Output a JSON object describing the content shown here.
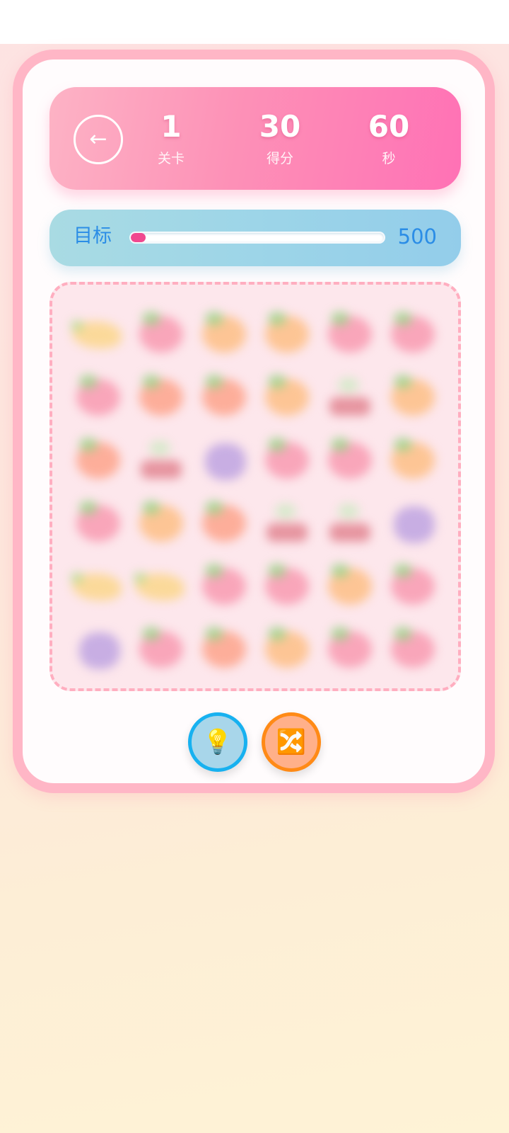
{
  "header": {
    "back_icon": "←",
    "level": {
      "value": "1",
      "label": "关卡"
    },
    "score": {
      "value": "30",
      "label": "得分"
    },
    "timer": {
      "value": "60",
      "label": "秒"
    }
  },
  "target": {
    "label": "目标",
    "value": "500",
    "progress_fraction": 0.06
  },
  "colors": {
    "strawberry": "#f9a6ba",
    "peach": "#fdae9a",
    "orange": "#fdc595",
    "banana": "#fbd99a",
    "grape": "#c8aee3",
    "cherry": "#e6949f",
    "progress_fill": "#f0488f",
    "target_text": "#2b8de6"
  },
  "board": {
    "rows": [
      [
        "banana",
        "strawberry",
        "orange",
        "orange",
        "strawberry",
        "strawberry"
      ],
      [
        "strawberry",
        "peach",
        "peach",
        "orange",
        "cherry",
        "orange"
      ],
      [
        "peach",
        "cherry",
        "grape",
        "strawberry",
        "strawberry",
        "orange"
      ],
      [
        "strawberry",
        "orange",
        "peach",
        "cherry",
        "cherry",
        "grape"
      ],
      [
        "banana",
        "banana",
        "strawberry",
        "strawberry",
        "orange",
        "strawberry"
      ],
      [
        "grape",
        "strawberry",
        "peach",
        "orange",
        "strawberry",
        "strawberry"
      ]
    ]
  },
  "tools": {
    "hint_icon": "💡",
    "shuffle_icon": "🔀"
  }
}
